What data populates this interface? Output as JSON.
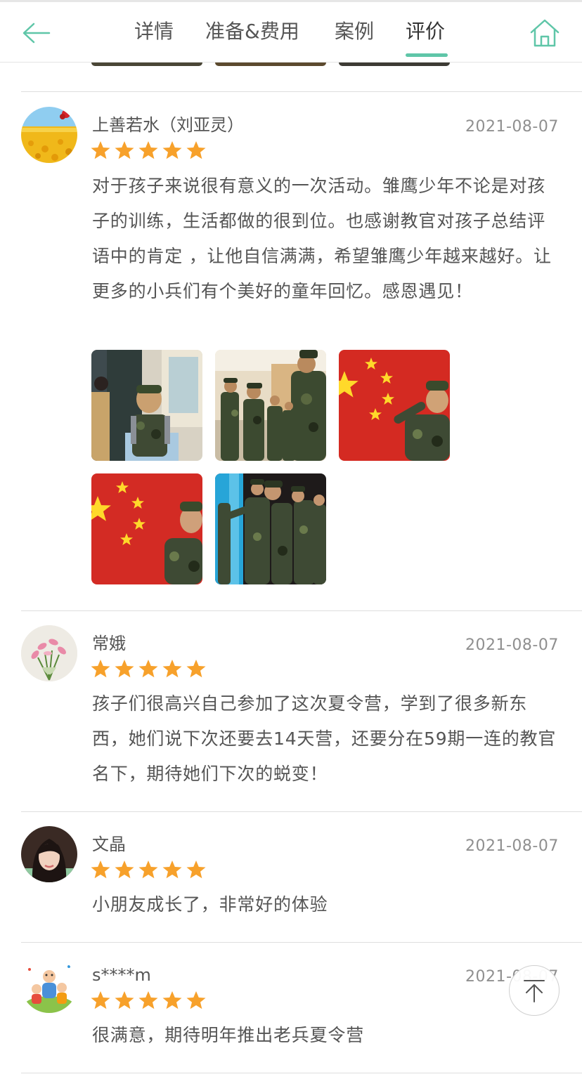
{
  "nav": {
    "tabs": [
      {
        "label": "详情",
        "active": false
      },
      {
        "label": "准备&费用",
        "active": false
      },
      {
        "label": "案例",
        "active": false
      },
      {
        "label": "评价",
        "active": true
      }
    ],
    "back_icon": "arrow-left-icon",
    "home_icon": "home-icon",
    "accent_color": "#5fc6a8"
  },
  "reviews": [
    {
      "user": "上善若水（刘亚灵）",
      "date": "2021-08-07",
      "rating": 5,
      "text": "对于孩子来说很有意义的一次活动。雏鹰少年不论是对孩子的训练，生活都做的很到位。也感谢教官对孩子总结评语中的肯定 ，让他自信满满，希望雏鹰少年越来越好。让更多的小兵们有个美好的童年回忆。感恩遇见！",
      "photos": 5
    },
    {
      "user": "常娥",
      "date": "2021-08-07",
      "rating": 5,
      "text": "孩子们很高兴自己参加了这次夏令营，学到了很多新东西，她们说下次还要去14天营，还要分在59期一连的教官名下，期待她们下次的蜕变！"
    },
    {
      "user": "文晶",
      "date": "2021-08-07",
      "rating": 5,
      "text": "小朋友成长了，非常好的体验"
    },
    {
      "user": "s****m",
      "date": "2021-08-07",
      "rating": 5,
      "text": "很满意，期待明年推出老兵夏令营"
    }
  ],
  "star_color": "#f7a12b",
  "scroll_top_icon": "arrow-up-icon"
}
